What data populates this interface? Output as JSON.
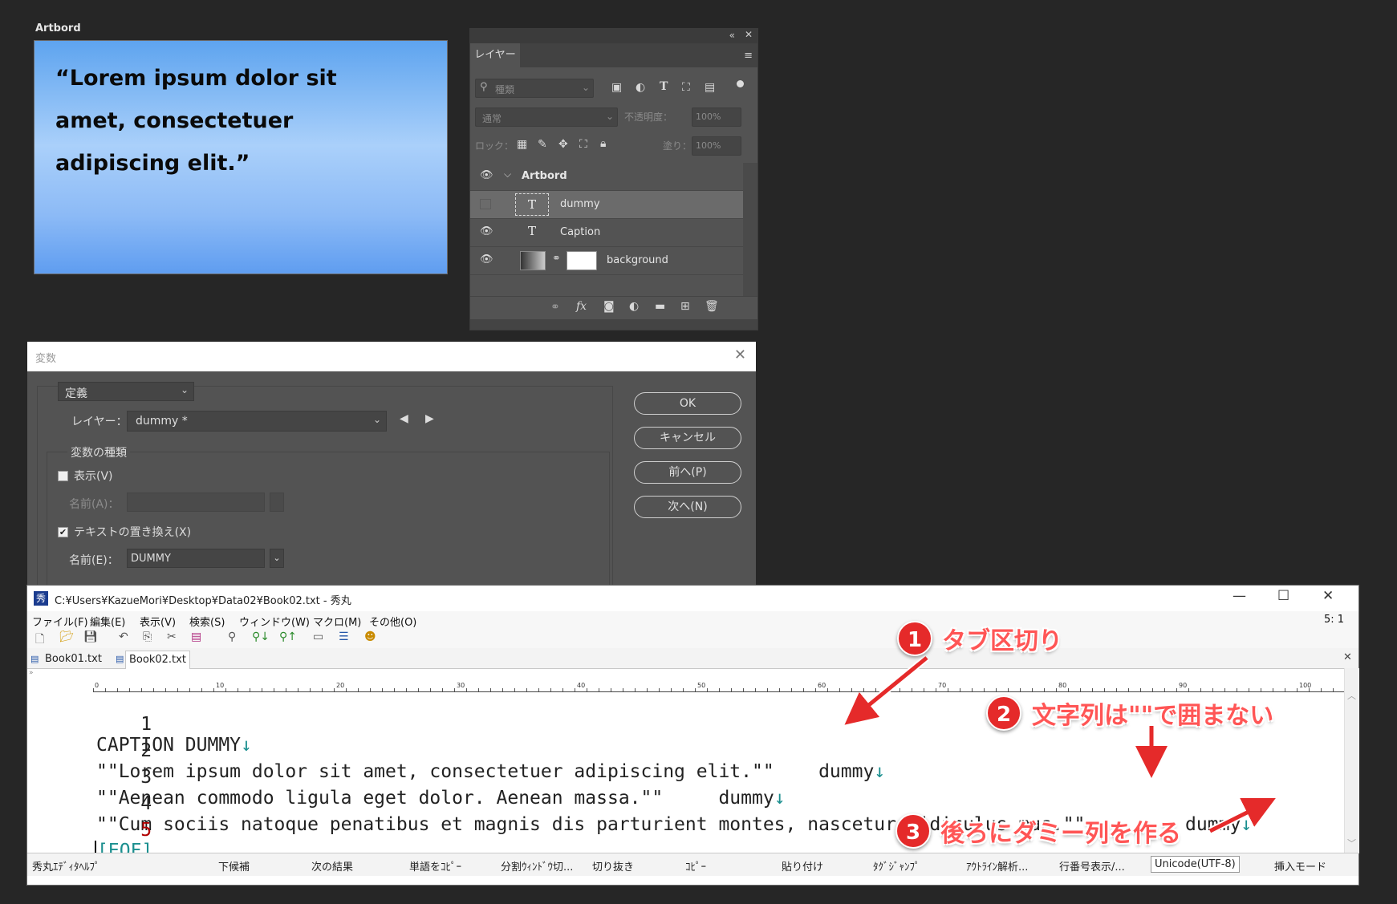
{
  "artboard": {
    "label": "Artbord",
    "quote": "“Lorem ipsum dolor sit amet, consectetuer adipiscing elit.”"
  },
  "layers_panel": {
    "tab": "レイヤー",
    "filter_placeholder": "種類",
    "blend_mode": "通常",
    "opacity_label": "不透明度：",
    "opacity_value": "100%",
    "lock_label": "ロック：",
    "fill_label": "塗り：",
    "fill_value": "100%",
    "layers": [
      {
        "name": "Artbord",
        "type": "artboard"
      },
      {
        "name": "dummy",
        "type": "text",
        "selected": true
      },
      {
        "name": "Caption",
        "type": "text"
      },
      {
        "name": "background",
        "type": "image"
      }
    ]
  },
  "variables_dialog": {
    "title": "変数",
    "mode": "定義",
    "layer_label": "レイヤー：",
    "layer_value": "dummy *",
    "group_label": "変数の種類",
    "visibility_label": "表示(V)",
    "name_a_label": "名前(A)：",
    "text_replace_label": "テキストの置き換え(X)",
    "name_e_label": "名前(E)：",
    "name_e_value": "DUMMY",
    "buttons": {
      "ok": "OK",
      "cancel": "キャンセル",
      "prev": "前へ(P)",
      "next": "次へ(N)"
    }
  },
  "editor": {
    "title": "C:¥Users¥KazueMori¥Desktop¥Data02¥Book02.txt - 秀丸",
    "menu": [
      "ファイル(F)",
      "編集(E)",
      "表示(V)",
      "検索(S)",
      "ウィンドウ(W)",
      "マクロ(M)",
      "その他(O)"
    ],
    "cursor_pos": "5: 1",
    "tabs": [
      "Book01.txt",
      "Book02.txt"
    ],
    "ruler_marks": [
      "0",
      "10",
      "20",
      "30",
      "40",
      "50",
      "60",
      "70",
      "80",
      "90",
      "100"
    ],
    "lines": [
      {
        "num": "1",
        "text": "CAPTION DUMMY",
        "eol": "↓"
      },
      {
        "num": "2",
        "text": "\"\"Lorem ipsum dolor sit amet, consectetuer adipiscing elit.\"\"    dummy",
        "eol": "↓"
      },
      {
        "num": "3",
        "text": "\"\"Aenean commodo ligula eget dolor. Aenean massa.\"\"     dummy",
        "eol": "↓"
      },
      {
        "num": "4",
        "text": "\"\"Cum sociis natoque penatibus et magnis dis parturient montes, nascetur ridiculus mus.\"\"         dummy",
        "eol": "↓"
      },
      {
        "num": "5",
        "text": "",
        "eol": "[EOF]"
      }
    ],
    "status": [
      "秀丸ｴﾃﾞｨﾀﾍﾙﾌﾟ",
      "下候補",
      "次の結果",
      "単語をｺﾋﾟｰ",
      "分割ｳｨﾝﾄﾞｳ切...",
      "切り抜き",
      "ｺﾋﾟｰ",
      "貼り付け",
      "ﾀｸﾞｼﾞｬﾝﾌﾟ",
      "ｱｳﾄﾗｲﾝ解析...",
      "行番号表示/...",
      "Unicode(UTF-8)",
      "挿入モード"
    ]
  },
  "annotations": [
    {
      "num": "1",
      "text": "タブ区切り"
    },
    {
      "num": "2",
      "text": "文字列は\"\"で囲まない"
    },
    {
      "num": "3",
      "text": "後ろにダミー列を作る"
    }
  ],
  "colors": {
    "accent_red": "#e52a2a",
    "eol_teal": "#1b8f8f"
  }
}
